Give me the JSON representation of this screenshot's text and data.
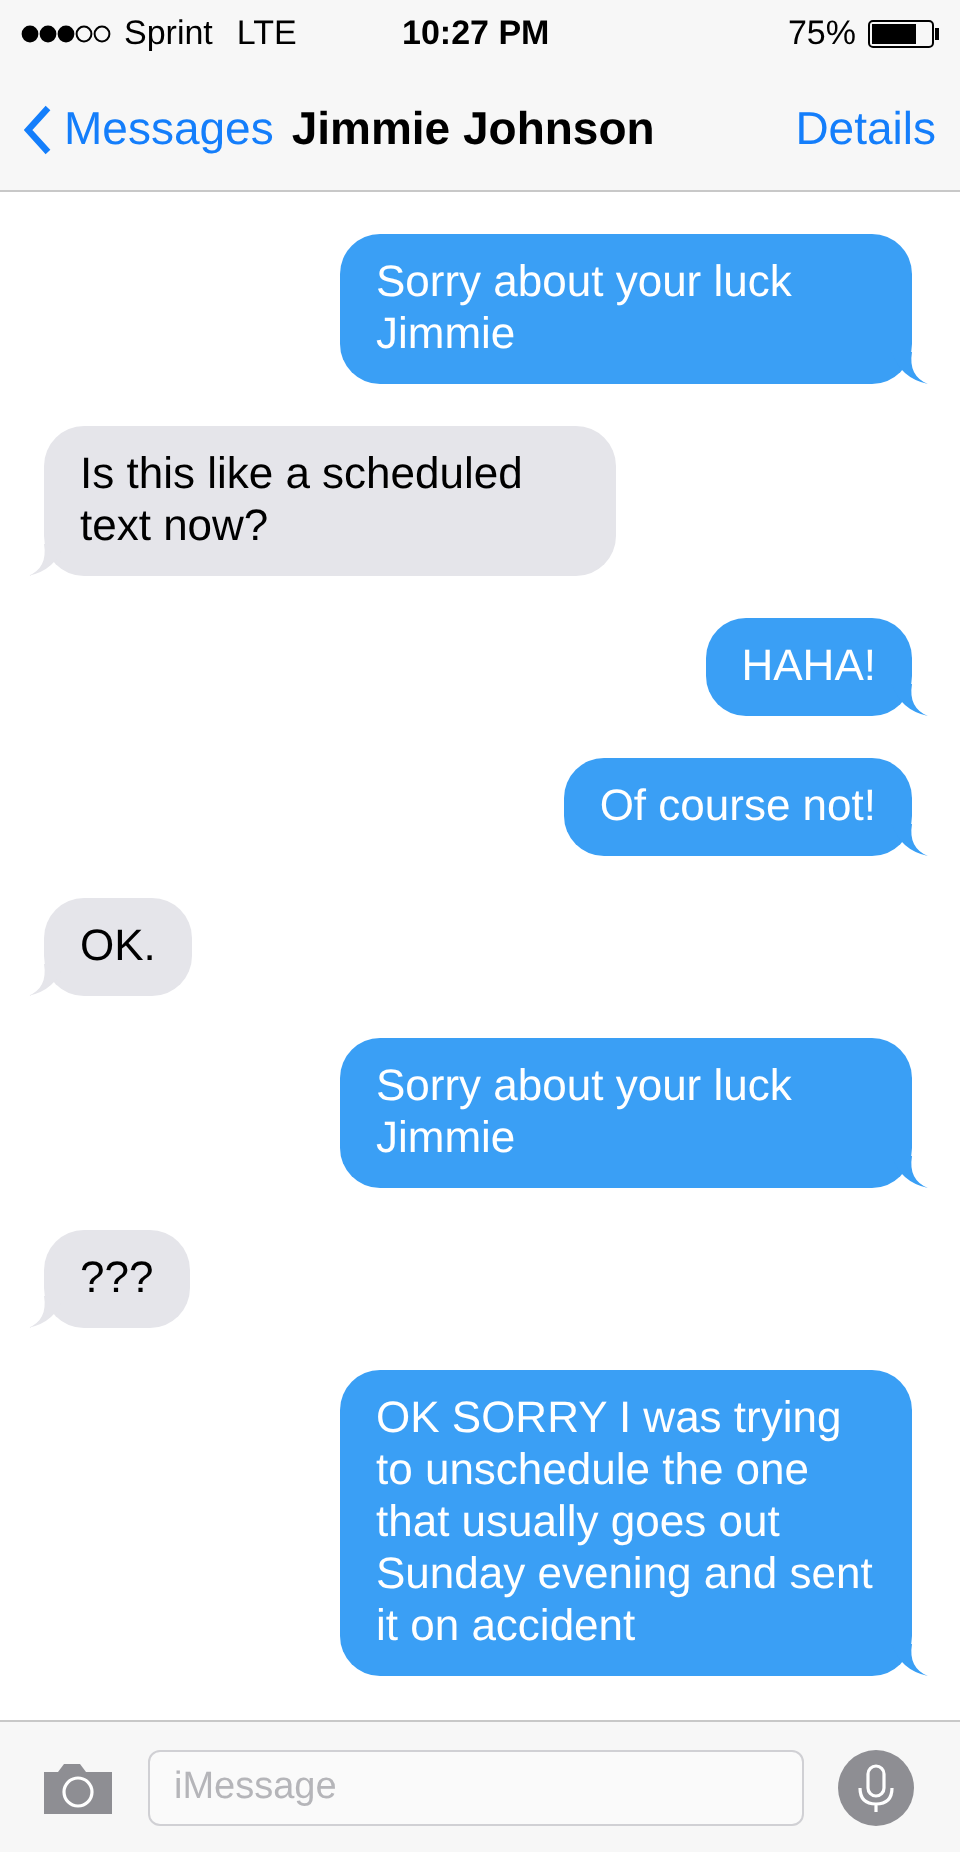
{
  "status_bar": {
    "carrier": "Sprint",
    "network": "LTE",
    "time": "10:27 PM",
    "battery_percent": "75%"
  },
  "nav_bar": {
    "back_label": "Messages",
    "title": "Jimmie Johnson",
    "action_label": "Details"
  },
  "messages": [
    {
      "kind": "sent",
      "text": "Sorry about your luck Jimmie"
    },
    {
      "kind": "received",
      "text": "Is this like a scheduled text now?"
    },
    {
      "kind": "sent",
      "text": "HAHA!"
    },
    {
      "kind": "sent",
      "text": "Of course not!"
    },
    {
      "kind": "received",
      "text": "OK."
    },
    {
      "kind": "sent",
      "text": "Sorry about your luck Jimmie"
    },
    {
      "kind": "received",
      "text": "???"
    },
    {
      "kind": "sent",
      "text": "OK SORRY I was trying to unschedule the one that usually goes out Sunday evening and sent it on accident"
    }
  ],
  "composer": {
    "placeholder": "iMessage"
  }
}
